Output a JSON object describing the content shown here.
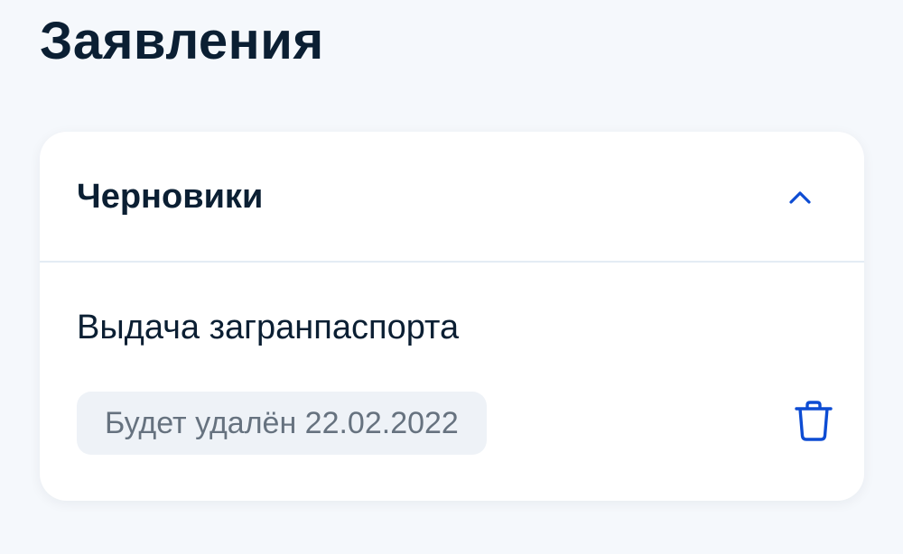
{
  "page": {
    "title": "Заявления"
  },
  "drafts_section": {
    "title": "Черновики",
    "expanded": true,
    "toggle_icon": "chevron-up-icon",
    "items": [
      {
        "title": "Выдача загранпаспорта",
        "status": "Будет удалён 22.02.2022",
        "delete_icon": "trash-icon"
      }
    ]
  },
  "colors": {
    "background": "#f5f8fc",
    "card": "#ffffff",
    "text_primary": "#0b1f33",
    "text_secondary": "#66727f",
    "badge_background": "#eef2f7",
    "accent": "#0d4cd3",
    "divider": "#e4ecf4"
  }
}
